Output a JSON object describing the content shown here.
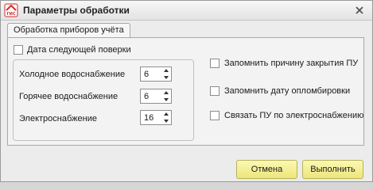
{
  "window": {
    "title": "Параметры обработки",
    "icon_text": "ГИС"
  },
  "tab": {
    "label": "Обработка приборов учёта"
  },
  "options": {
    "next_check_date": {
      "label": "Дата следующей поверки",
      "checked": false
    },
    "remember_close_reason": {
      "label": "Запомнить причину закрытия ПУ",
      "checked": false
    },
    "remember_seal_date": {
      "label": "Запомнить дату опломбировки",
      "checked": false
    },
    "link_by_electricity": {
      "label": "Связать ПУ по электроснабжению",
      "checked": false
    }
  },
  "services": [
    {
      "label": "Холодное водоснабжение",
      "value": "6"
    },
    {
      "label": "Горячее водоснабжение",
      "value": "6"
    },
    {
      "label": "Электроснабжение",
      "value": "16"
    }
  ],
  "buttons": {
    "cancel": "Отмена",
    "execute": "Выполнить"
  },
  "colors": {
    "button_fill": "#f2ec8a",
    "title_bar": "#ededed",
    "icon_red": "#d42b2b"
  }
}
